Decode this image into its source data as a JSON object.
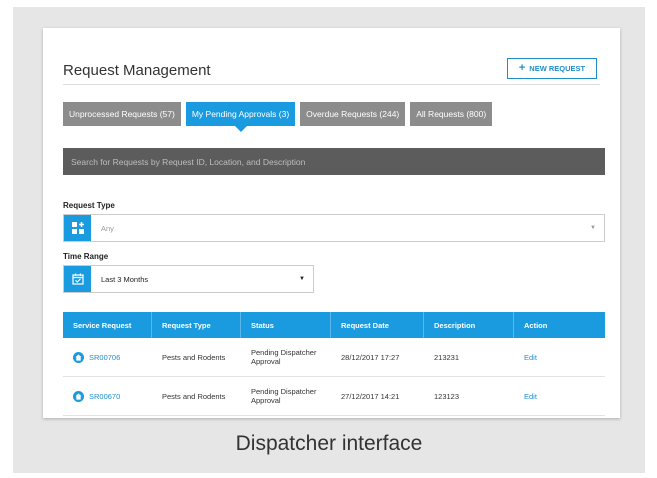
{
  "page": {
    "title": "Request Management",
    "new_request_label": "NEW REQUEST",
    "caption": "Dispatcher interface"
  },
  "tabs": [
    {
      "label": "Unprocessed Requests (57)",
      "active": false
    },
    {
      "label": "My Pending Approvals (3)",
      "active": true
    },
    {
      "label": "Overdue Requests (244)",
      "active": false
    },
    {
      "label": "All Requests (800)",
      "active": false
    }
  ],
  "search": {
    "placeholder": "Search for Requests by Request ID, Location, and Description"
  },
  "filters": {
    "request_type": {
      "label": "Request Type",
      "value": "Any"
    },
    "time_range": {
      "label": "Time Range",
      "value": "Last 3 Months"
    }
  },
  "table": {
    "headers": [
      "Service Request",
      "Request Type",
      "Status",
      "Request Date",
      "Description",
      "Action"
    ],
    "rows": [
      {
        "id": "SR00706",
        "type": "Pests and Rodents",
        "status": "Pending Dispatcher Approval",
        "date": "28/12/2017 17:27",
        "description": "213231",
        "action": "Edit"
      },
      {
        "id": "SR00670",
        "type": "Pests and Rodents",
        "status": "Pending Dispatcher Approval",
        "date": "27/12/2017 14:21",
        "description": "123123",
        "action": "Edit"
      }
    ]
  },
  "colors": {
    "accent": "#1a9be0",
    "tab_inactive": "#8c8c8c",
    "search_bg": "#5c5c5c"
  }
}
